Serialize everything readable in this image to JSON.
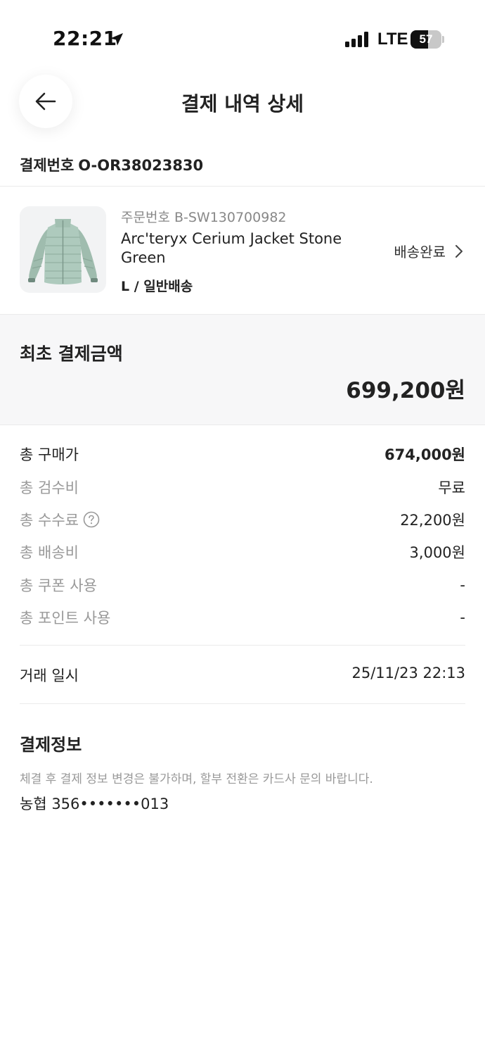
{
  "status_bar": {
    "time": "22:21",
    "network": "LTE",
    "battery": "57",
    "battery_level": 0.57
  },
  "header": {
    "title": "결제 내역 상세"
  },
  "payment_number": {
    "label": "결제번호",
    "value": "O-OR38023830"
  },
  "product": {
    "order_number": "주문번호 B-SW130700982",
    "name": "Arc'teryx Cerium Jacket Stone Green",
    "option": "L / 일반배송",
    "status": "배송완료"
  },
  "initial_payment": {
    "label": "최초 결제금액",
    "amount": "699,200원"
  },
  "breakdown": [
    {
      "label": "총 구매가",
      "value": "674,000원"
    },
    {
      "label": "총 검수비",
      "value": "무료"
    },
    {
      "label": "총 수수료",
      "value": "22,200원"
    },
    {
      "label": "총 배송비",
      "value": "3,000원"
    },
    {
      "label": "총 쿠폰 사용",
      "value": "-"
    },
    {
      "label": "총 포인트 사용",
      "value": "-"
    }
  ],
  "transaction": {
    "label": "거래 일시",
    "value": "25/11/23 22:13"
  },
  "payment_info": {
    "title": "결제정보",
    "notice": "체결 후 결제 정보 변경은 불가하며, 할부 전환은 카드사 문의 바랍니다.",
    "card": "농협 356•••••••013"
  },
  "icons": {
    "back": "arrow-left-icon",
    "location": "location-arrow-icon",
    "signal": "cellular-signal-icon",
    "battery": "battery-icon",
    "chevron": "chevron-right-icon",
    "help": "question-circle-icon"
  },
  "colors": {
    "jacket": "#a9c5b8",
    "muted_text": "#999999",
    "panel": "#f7f7f8"
  }
}
